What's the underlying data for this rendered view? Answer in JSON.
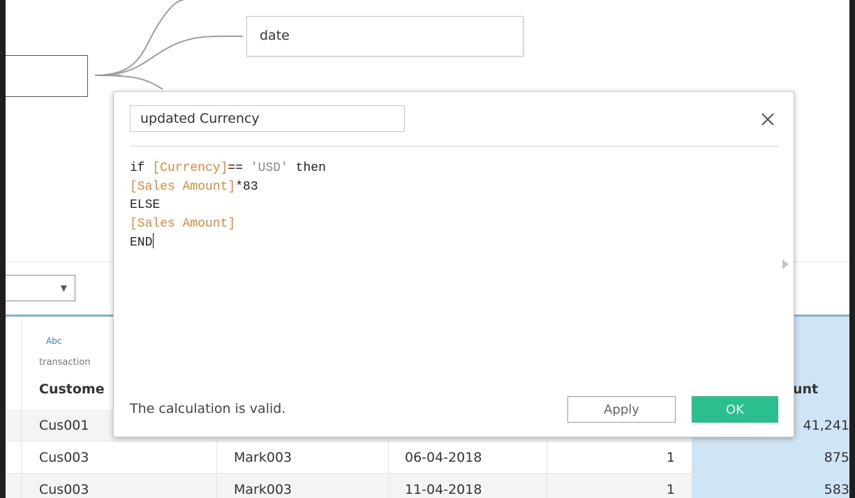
{
  "canvas": {
    "date_table": {
      "label": "date"
    }
  },
  "grid": {
    "column_header": {
      "type_label": "Abc",
      "source": "transaction",
      "name": "Custome",
      "amount_name": "unt"
    },
    "rows": [
      {
        "customer": "Cus001",
        "market": "",
        "date": "",
        "qty": "",
        "amount": "41,241"
      },
      {
        "customer": "Cus003",
        "market": "Mark003",
        "date": "06-04-2018",
        "qty": "1",
        "amount": "875"
      },
      {
        "customer": "Cus003",
        "market": "Mark003",
        "date": "11-04-2018",
        "qty": "1",
        "amount": "583"
      }
    ]
  },
  "dialog": {
    "calc_name": "updated Currency",
    "formula": {
      "line1_kw": "if ",
      "line1_field": "[Currency]",
      "line1_op": "== ",
      "line1_str": "'USD'",
      "line1_tail": " then",
      "line2_field": "[Sales Amount]",
      "line2_tail": "*83",
      "line3": "ELSE",
      "line4_field": "[Sales Amount]",
      "line5": "END"
    },
    "status": "The calculation is valid.",
    "apply_label": "Apply",
    "ok_label": "OK"
  },
  "colors": {
    "ok_button": "#2bbf8f",
    "field_reference": "#e0883a",
    "amount_column": "#cfe4f5",
    "header_accent": "#7cb6c9"
  },
  "icons": {
    "close": "close-icon",
    "dropdown": "chevron-down-icon",
    "expand": "caret-right-icon"
  }
}
